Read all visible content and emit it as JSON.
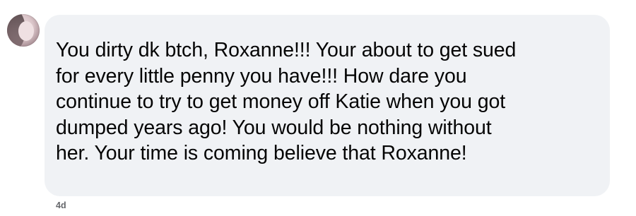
{
  "comment": {
    "text": "You dirty dk btch, Roxanne!!! Your about to get sued\nfor every little penny you have!!! How dare you\ncontinue to try to get money off Katie when you got\ndumped years ago! You would be nothing without\nher. Your time is coming believe that Roxanne!",
    "timestamp": "4d"
  },
  "colors": {
    "bubble_background": "#f0f2f5",
    "text": "#050505",
    "timestamp": "#65676b"
  },
  "icons": {
    "avatar": "profile-photo"
  }
}
